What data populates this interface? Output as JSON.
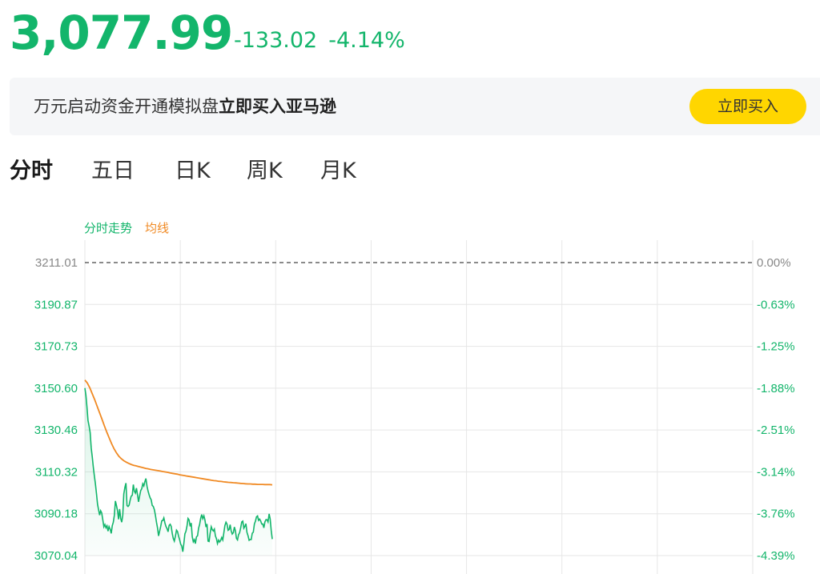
{
  "quote": {
    "price": "3,077.99",
    "change": "-133.02",
    "change_pct": "-4.14%"
  },
  "banner": {
    "text_normal": "万元启动资金开通模拟盘",
    "text_bold": "立即买入亚马逊",
    "button_label": "立即买入"
  },
  "tabs": [
    {
      "label": "分时",
      "active": true
    },
    {
      "label": "五日",
      "active": false
    },
    {
      "label": "日K",
      "active": false
    },
    {
      "label": "周K",
      "active": false
    },
    {
      "label": "月K",
      "active": false
    }
  ],
  "legend": {
    "price_line": "分时走势",
    "avg_line": "均线"
  },
  "colors": {
    "up_green": "#13b56b",
    "avg_orange": "#f08a24",
    "accent_yellow": "#ffd600"
  },
  "chart_data": {
    "type": "line",
    "title": "",
    "xlabel": "",
    "ylabel": "",
    "ylim": [
      3070.04,
      3211.01
    ],
    "prev_close": 3211.01,
    "y_ticks": [
      "3211.01",
      "3190.87",
      "3170.73",
      "3150.60",
      "3130.46",
      "3110.32",
      "3090.18",
      "3070.04"
    ],
    "y_ticks_right": [
      "0.00%",
      "-0.63%",
      "-1.25%",
      "-1.88%",
      "-2.51%",
      "-3.14%",
      "-3.76%",
      "-4.39%"
    ],
    "grid": true,
    "x_grid_divisions": 7,
    "series": [
      {
        "name": "分时走势",
        "values": [
          3150.6,
          3147.2,
          3141.5,
          3135.0,
          3132.3,
          3129.2,
          3121.8,
          3117.6,
          3112.7,
          3108.5,
          3104.7,
          3099.8,
          3094.8,
          3092.1,
          3089.5,
          3091.6,
          3090.6,
          3087.5,
          3083.9,
          3085.0,
          3083.5,
          3084.4,
          3081.8,
          3084.0,
          3082.7,
          3080.7,
          3084.4,
          3086.1,
          3089.4,
          3096.3,
          3094.2,
          3091.6,
          3087.5,
          3092.4,
          3088.0,
          3086.1,
          3089.4,
          3099.7,
          3102.9,
          3104.9,
          3094.1,
          3093.7,
          3094.3,
          3096.7,
          3098.6,
          3099.1,
          3104.2,
          3101.0,
          3100.1,
          3102.5,
          3099.4,
          3095.9,
          3098.8,
          3101.3,
          3102.2,
          3104.6,
          3103.6,
          3105.6,
          3107.1,
          3103.4,
          3101.1,
          3099.3,
          3097.8,
          3096.9,
          3094.2,
          3093.7,
          3092.1,
          3089.4,
          3086.1,
          3083.4,
          3079.5,
          3081.7,
          3084.1,
          3086.8,
          3086.9,
          3088.2,
          3085.8,
          3084.1,
          3083.1,
          3081.5,
          3084.6,
          3085.1,
          3084.1,
          3080.7,
          3078.3,
          3077.0,
          3079.5,
          3082.3,
          3081.6,
          3079.4,
          3077.7,
          3075.6,
          3074.7,
          3071.9,
          3075.9,
          3080.5,
          3081.7,
          3084.2,
          3087.9,
          3087.2,
          3084.1,
          3085.7,
          3079.1,
          3076.7,
          3077.7,
          3075.8,
          3079.0,
          3079.6,
          3083.2,
          3085.1,
          3087.9,
          3089.8,
          3087.8,
          3089.2,
          3087.2,
          3083.8,
          3085.2,
          3077.0,
          3076.8,
          3080.8,
          3083.9,
          3082.5,
          3081.9,
          3082.8,
          3079.5,
          3078.2,
          3075.8,
          3077.5,
          3076.6,
          3077.4,
          3078.8,
          3077.6,
          3080.9,
          3084.4,
          3086.1,
          3085.2,
          3082.2,
          3082.6,
          3084.9,
          3081.9,
          3080.4,
          3081.1,
          3083.8,
          3081.9,
          3078.3,
          3077.6,
          3080.1,
          3081.0,
          3083.5,
          3086.2,
          3086.6,
          3083.2,
          3084.1,
          3085.4,
          3081.2,
          3079.5,
          3077.4,
          3077.8,
          3077.8,
          3080.8,
          3081.3,
          3085.3,
          3086.6,
          3088.7,
          3089.1,
          3087.0,
          3087.6,
          3086.7,
          3085.2,
          3085.2,
          3083.4,
          3086.2,
          3087.3,
          3087.3,
          3086.2,
          3090.1,
          3087.6,
          3082.1,
          3077.99
        ]
      },
      {
        "name": "均线",
        "values": [
          3154.5,
          3153.1,
          3150.8,
          3148.0,
          3145.1,
          3142.0,
          3138.9,
          3135.7,
          3132.5,
          3129.4,
          3126.6,
          3123.9,
          3121.4,
          3119.4,
          3117.8,
          3116.6,
          3115.7,
          3115.0,
          3114.4,
          3113.9,
          3113.5,
          3113.2,
          3112.9,
          3112.6,
          3112.3,
          3112.0,
          3111.8,
          3111.5,
          3111.3,
          3111.1,
          3110.9,
          3110.7,
          3110.5,
          3110.3,
          3110.1,
          3109.8,
          3109.6,
          3109.4,
          3109.2,
          3108.9,
          3108.7,
          3108.5,
          3108.3,
          3108.1,
          3107.9,
          3107.7,
          3107.5,
          3107.3,
          3107.1,
          3106.9,
          3106.7,
          3106.5,
          3106.3,
          3106.1,
          3106.0,
          3105.8,
          3105.7,
          3105.5,
          3105.4,
          3105.3,
          3105.2,
          3105.1,
          3105.0,
          3104.9,
          3104.8,
          3104.7,
          3104.6,
          3104.5,
          3104.5,
          3104.4,
          3104.4,
          3104.3,
          3104.3,
          3104.3,
          3104.2,
          3104.2,
          3104.2,
          3104.1
        ]
      }
    ]
  }
}
